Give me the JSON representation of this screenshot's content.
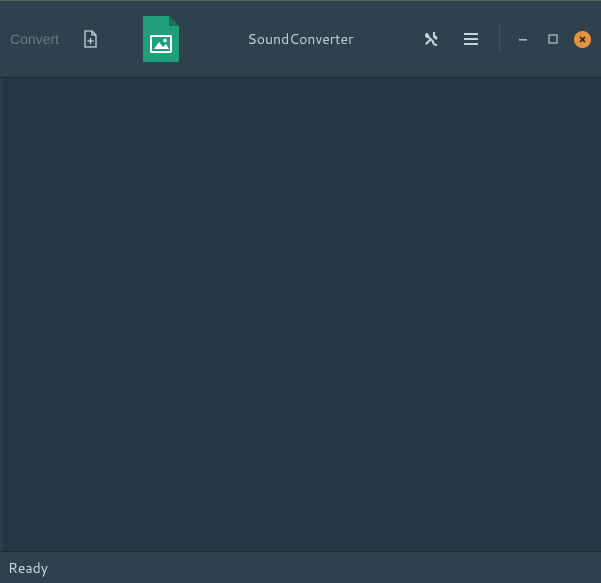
{
  "header": {
    "convert_label": "Convert",
    "title": "SoundConverter"
  },
  "status": {
    "text": "Ready"
  },
  "icons": {
    "add_file": "add-file-icon",
    "app": "app-image-file-icon",
    "prefs": "tools-icon",
    "menu": "hamburger-icon",
    "minimize": "minimize-icon",
    "maximize": "maximize-icon",
    "close": "close-icon"
  }
}
